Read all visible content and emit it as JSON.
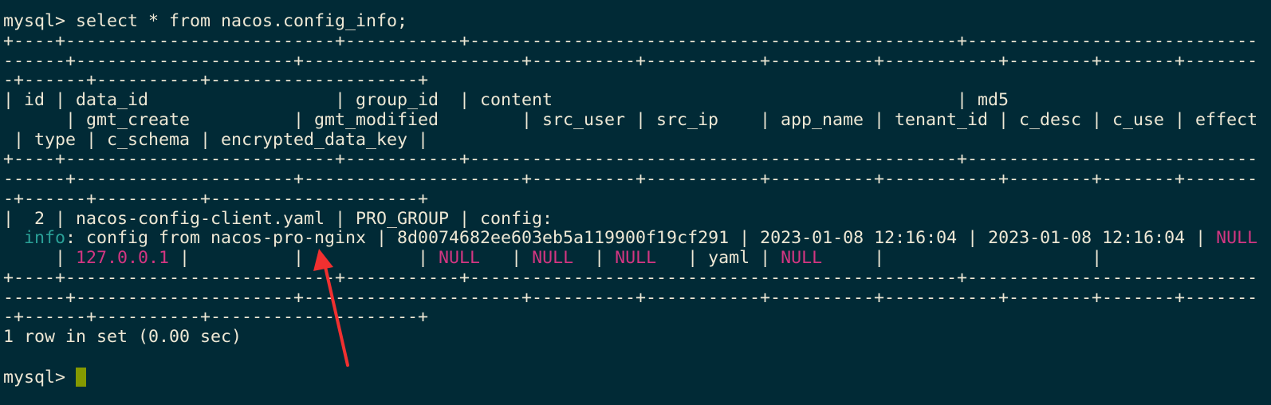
{
  "terminal": {
    "colors": {
      "background": "#012a36",
      "foreground": "#eee8d5",
      "info": "#2aa198",
      "null": "#d33682",
      "cursor": "#859900",
      "annotation_arrow": "#f03030"
    },
    "lines": [
      [
        {
          "t": "mysql> select * from nacos.config_info;"
        }
      ],
      [
        {
          "t": "+----+--------------------------+-----------+-----------------------------------------------+----------------------------"
        }
      ],
      [
        {
          "t": "------+---------------------+---------------------+----------+-----------+----------+-----------+--------+-------+-------"
        }
      ],
      [
        {
          "t": "-+------+----------+--------------------+"
        }
      ],
      [
        {
          "t": "| id | data_id                  | group_id  | content                                       | md5"
        }
      ],
      [
        {
          "t": "      | gmt_create          | gmt_modified        | src_user | src_ip    | app_name | tenant_id | c_desc | c_use | effect"
        }
      ],
      [
        {
          "t": " | type | c_schema | encrypted_data_key |"
        }
      ],
      [
        {
          "t": "+----+--------------------------+-----------+-----------------------------------------------+----------------------------"
        }
      ],
      [
        {
          "t": "------+---------------------+---------------------+----------+-----------+----------+-----------+--------+-------+-------"
        }
      ],
      [
        {
          "t": "-+------+----------+--------------------+"
        }
      ],
      [
        {
          "t": "|  2 | nacos-config-client.yaml | PRO_GROUP | config:"
        }
      ],
      [
        {
          "t": "  "
        },
        {
          "t": "info",
          "c": "info"
        },
        {
          "t": ": config from nacos-pro-nginx | 8d0074682ee603eb5a119900f19cf291 | 2023-01-08 12:16:04 | 2023-01-08 12:16:04 | "
        },
        {
          "t": "NULL",
          "c": "null"
        }
      ],
      [
        {
          "t": "     | "
        },
        {
          "t": "127.0.0.1",
          "c": "null"
        },
        {
          "t": " |          |           | "
        },
        {
          "t": "NULL",
          "c": "null"
        },
        {
          "t": "   | "
        },
        {
          "t": "NULL",
          "c": "null"
        },
        {
          "t": "  | "
        },
        {
          "t": "NULL",
          "c": "null"
        },
        {
          "t": "   | yaml | "
        },
        {
          "t": "NULL",
          "c": "null"
        },
        {
          "t": "     |                    |"
        }
      ],
      [
        {
          "t": "+----+--------------------------+-----------+-----------------------------------------------+----------------------------"
        }
      ],
      [
        {
          "t": "------+---------------------+---------------------+----------+-----------+----------+-----------+--------+-------+-------"
        }
      ],
      [
        {
          "t": "-+------+----------+--------------------+"
        }
      ],
      [
        {
          "t": "1 row in set (0.00 sec)"
        }
      ],
      [
        {
          "t": ""
        }
      ],
      [
        {
          "t": "mysql> "
        }
      ]
    ],
    "cursor_icon": "block-cursor",
    "annotation": "red-arrow-icon"
  }
}
